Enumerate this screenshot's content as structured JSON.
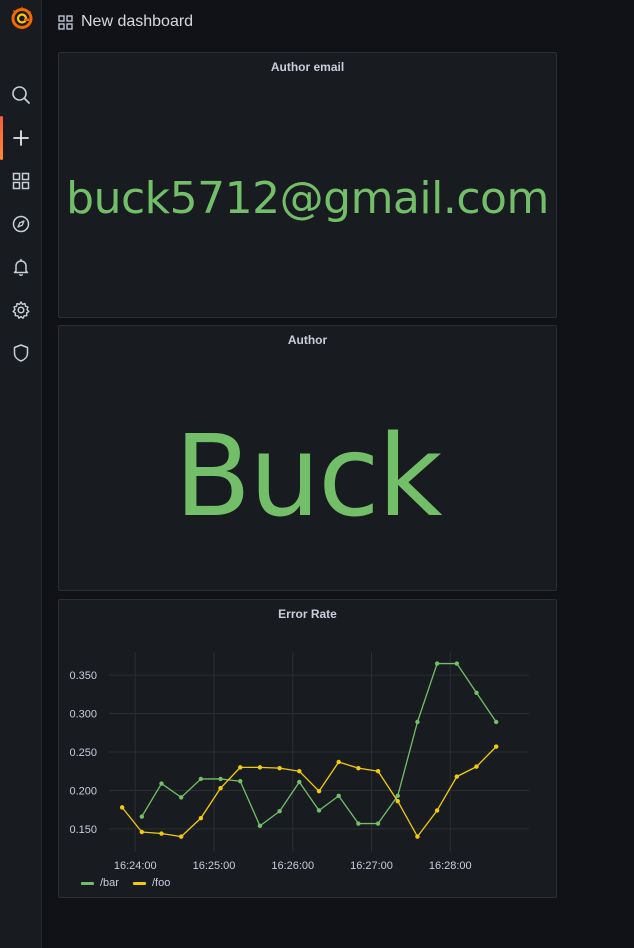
{
  "topbar": {
    "title": "New dashboard",
    "icon": "apps-icon"
  },
  "sidebar": {
    "logo": "grafana-logo",
    "items": [
      {
        "name": "search-icon",
        "active": false
      },
      {
        "name": "plus-icon",
        "active": true
      },
      {
        "name": "dashboards-icon",
        "active": false
      },
      {
        "name": "compass-icon",
        "active": false
      },
      {
        "name": "bell-icon",
        "active": false
      },
      {
        "name": "gear-icon",
        "active": false
      },
      {
        "name": "shield-icon",
        "active": false
      }
    ]
  },
  "panels": {
    "email": {
      "title": "Author email",
      "value": "buck5712@gmail.com"
    },
    "author": {
      "title": "Author",
      "value": "Buck"
    },
    "error_rate": {
      "title": "Error Rate"
    }
  },
  "colors": {
    "stat_green": "#73bf69",
    "series_bar": "#73bf69",
    "series_foo": "#f2cc0c",
    "accent": "#f55f3e"
  },
  "chart_data": {
    "type": "line",
    "title": "Error Rate",
    "x_ticks": [
      "16:24:00",
      "16:25:00",
      "16:26:00",
      "16:27:00",
      "16:28:00"
    ],
    "y_ticks": [
      "0.150",
      "0.200",
      "0.250",
      "0.300",
      "0.350"
    ],
    "ylim": [
      0.12,
      0.38
    ],
    "x_minutes_range": [
      "16:23:40",
      "16:29:00"
    ],
    "x": [
      "16:23:50",
      "16:24:05",
      "16:24:20",
      "16:24:35",
      "16:24:50",
      "16:25:05",
      "16:25:20",
      "16:25:35",
      "16:25:50",
      "16:26:05",
      "16:26:20",
      "16:26:35",
      "16:26:50",
      "16:27:05",
      "16:27:20",
      "16:27:35",
      "16:27:50",
      "16:28:05",
      "16:28:20",
      "16:28:35",
      "16:28:50"
    ],
    "series": [
      {
        "name": "/bar",
        "color": "#73bf69",
        "values": [
          null,
          0.166,
          0.209,
          0.191,
          0.215,
          0.215,
          0.212,
          0.154,
          0.173,
          0.211,
          0.174,
          0.193,
          0.157,
          0.157,
          0.193,
          0.289,
          0.365,
          0.365,
          0.327,
          0.289,
          null
        ]
      },
      {
        "name": "/foo",
        "color": "#f2cc0c",
        "values": [
          0.178,
          0.146,
          0.144,
          0.14,
          0.164,
          0.203,
          0.23,
          0.23,
          0.229,
          0.225,
          0.199,
          0.237,
          0.229,
          0.225,
          0.186,
          0.14,
          0.174,
          0.218,
          0.231,
          0.257,
          null
        ]
      }
    ],
    "grid": true,
    "legend": "bottom-left"
  }
}
